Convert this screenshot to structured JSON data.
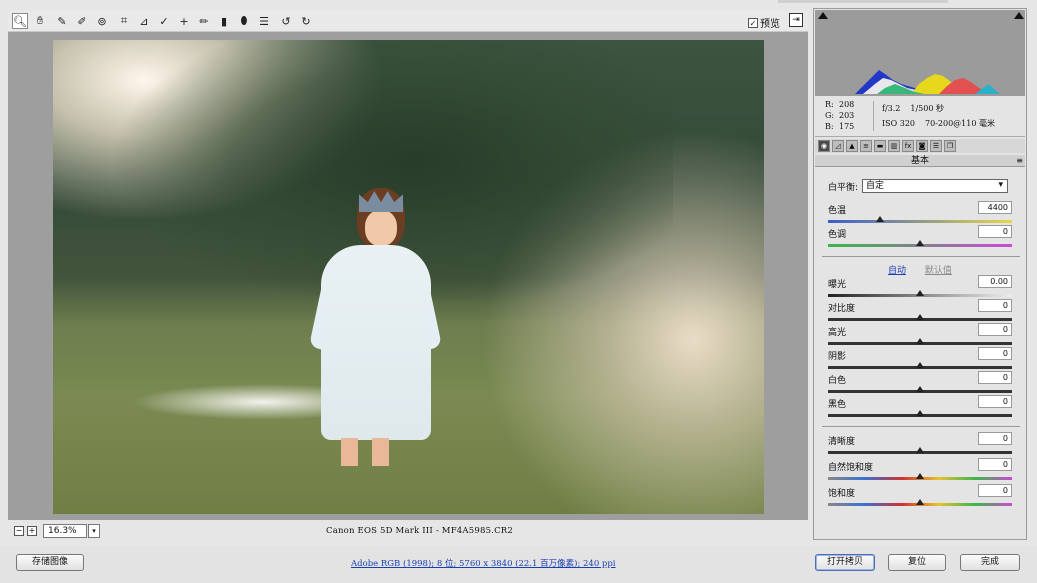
{
  "toolbar": {
    "tools": [
      "zoom-icon",
      "hand-icon",
      "white-balance-icon",
      "color-sampler-icon",
      "target-adjust-icon",
      "crop-icon",
      "straighten-icon",
      "spot-removal-icon",
      "red-eye-icon",
      "adjustment-brush-icon",
      "graduated-filter-icon",
      "radial-filter-icon",
      "preferences-icon",
      "rotate-ccw-icon",
      "rotate-cw-icon"
    ],
    "preview_label": "预览",
    "preview_checked": "✓"
  },
  "zoom": {
    "minus": "−",
    "plus": "+",
    "value": "16.3%",
    "dropdown": "▾"
  },
  "camera_info": "Canon EOS 5D Mark III  -  MF4A5985.CR2",
  "readout": {
    "r_label": "R:",
    "r": "208",
    "g_label": "G:",
    "g": "203",
    "b_label": "B:",
    "b": "175",
    "aperture": "f/3.2",
    "shutter": "1/500 秒",
    "iso": "ISO 320",
    "lens": "70-200@110 毫米"
  },
  "panel": {
    "section_title": "基本",
    "section_menu": "≡",
    "white_balance_label": "白平衡:",
    "white_balance_value": "自定",
    "auto_link": "自动",
    "default_link": "默认值",
    "sliders": {
      "temp": {
        "label": "色温",
        "value": "4400",
        "level": 0.28
      },
      "tint": {
        "label": "色调",
        "value": "0",
        "level": 0.5
      },
      "exposure": {
        "label": "曝光",
        "value": "0.00",
        "level": 0.5
      },
      "contrast": {
        "label": "对比度",
        "value": "0",
        "level": 0.5
      },
      "highlights": {
        "label": "高光",
        "value": "0",
        "level": 0.5
      },
      "shadows": {
        "label": "阴影",
        "value": "0",
        "level": 0.5
      },
      "whites": {
        "label": "白色",
        "value": "0",
        "level": 0.5
      },
      "blacks": {
        "label": "黑色",
        "value": "0",
        "level": 0.5
      },
      "clarity": {
        "label": "清晰度",
        "value": "0",
        "level": 0.5
      },
      "vibrance": {
        "label": "自然饱和度",
        "value": "0",
        "level": 0.5
      },
      "saturation": {
        "label": "饱和度",
        "value": "0",
        "level": 0.5
      }
    }
  },
  "bottom": {
    "save_label": "存储图像",
    "workflow": "Adobe RGB (1998); 8 位; 5760 x 3840 (22.1 百万像素); 240 ppi",
    "open_label": "打开拷贝",
    "reset_label": "复位",
    "done_label": "完成"
  }
}
